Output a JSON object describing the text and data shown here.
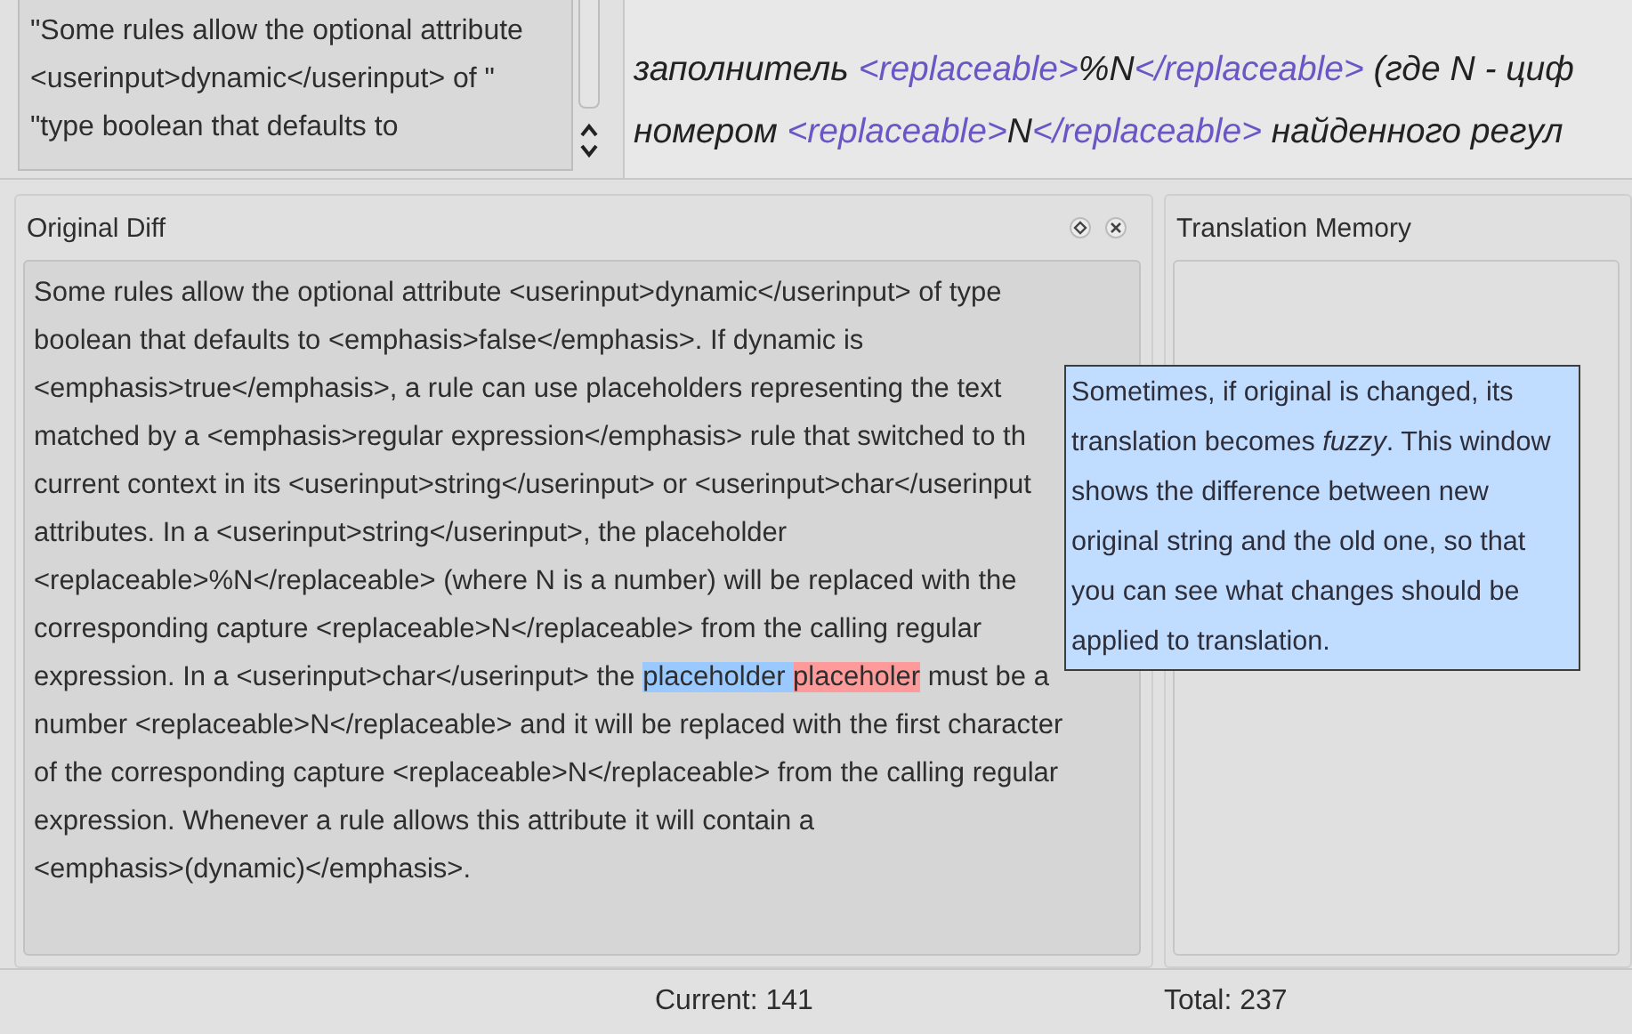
{
  "source_list": {
    "lines": [
      "\"Some rules allow the optional attribute",
      "<userinput>dynamic</userinput> of \"",
      "\"type boolean that defaults to"
    ]
  },
  "translation_editor": {
    "lines": [
      [
        {
          "kind": "text",
          "text": "заполнитель "
        },
        {
          "kind": "tag",
          "text": "<replaceable>"
        },
        {
          "kind": "text",
          "text": "%N"
        },
        {
          "kind": "tag",
          "text": "</replaceable>"
        },
        {
          "kind": "text",
          "text": " (где N - циф"
        }
      ],
      [
        {
          "kind": "text",
          "text": "номером "
        },
        {
          "kind": "tag",
          "text": "<replaceable>"
        },
        {
          "kind": "text",
          "text": "N"
        },
        {
          "kind": "tag",
          "text": "</replaceable>"
        },
        {
          "kind": "text",
          "text": " найденного регул"
        }
      ]
    ]
  },
  "original_diff": {
    "title": "Original Diff",
    "lines": [
      [
        {
          "kind": "plain",
          "text": "Some rules allow the optional attribute <userinput>dynamic</userinput> of type"
        }
      ],
      [
        {
          "kind": "plain",
          "text": "boolean that defaults to <emphasis>false</emphasis>. If dynamic is"
        }
      ],
      [
        {
          "kind": "plain",
          "text": "<emphasis>true</emphasis>, a rule can use placeholders representing the text"
        }
      ],
      [
        {
          "kind": "plain",
          "text": "matched by a <emphasis>regular expression</emphasis> rule that switched to th"
        }
      ],
      [
        {
          "kind": "plain",
          "text": "current context in its <userinput>string</userinput> or <userinput>char</userinput"
        }
      ],
      [
        {
          "kind": "plain",
          "text": "attributes. In a <userinput>string</userinput>, the placeholder"
        }
      ],
      [
        {
          "kind": "plain",
          "text": "<replaceable>%N</replaceable> (where N is a number) will be replaced with the"
        }
      ],
      [
        {
          "kind": "plain",
          "text": "corresponding capture <replaceable>N</replaceable> from the calling regular"
        }
      ],
      [
        {
          "kind": "plain",
          "text": "expression. In a <userinput>char</userinput> the "
        },
        {
          "kind": "added",
          "text": "placeholder "
        },
        {
          "kind": "removed",
          "text": "placeholer"
        },
        {
          "kind": "plain",
          "text": " must be a"
        }
      ],
      [
        {
          "kind": "plain",
          "text": "number <replaceable>N</replaceable> and it will be replaced with the first character"
        }
      ],
      [
        {
          "kind": "plain",
          "text": "of the corresponding capture <replaceable>N</replaceable> from the calling regular"
        }
      ],
      [
        {
          "kind": "plain",
          "text": "expression. Whenever a rule allows this attribute it will contain a"
        }
      ],
      [
        {
          "kind": "plain",
          "text": "<emphasis>(dynamic)</emphasis>."
        }
      ]
    ]
  },
  "translation_memory": {
    "title": "Translation Memory"
  },
  "tooltip": {
    "text": "Sometimes, if original is changed, its translation becomes *fuzzy*. This window shows the difference between new original string and the old one, so that you can see what changes should be applied to translation."
  },
  "status_bar": {
    "current": "Current: 141",
    "total": "Total: 237"
  }
}
